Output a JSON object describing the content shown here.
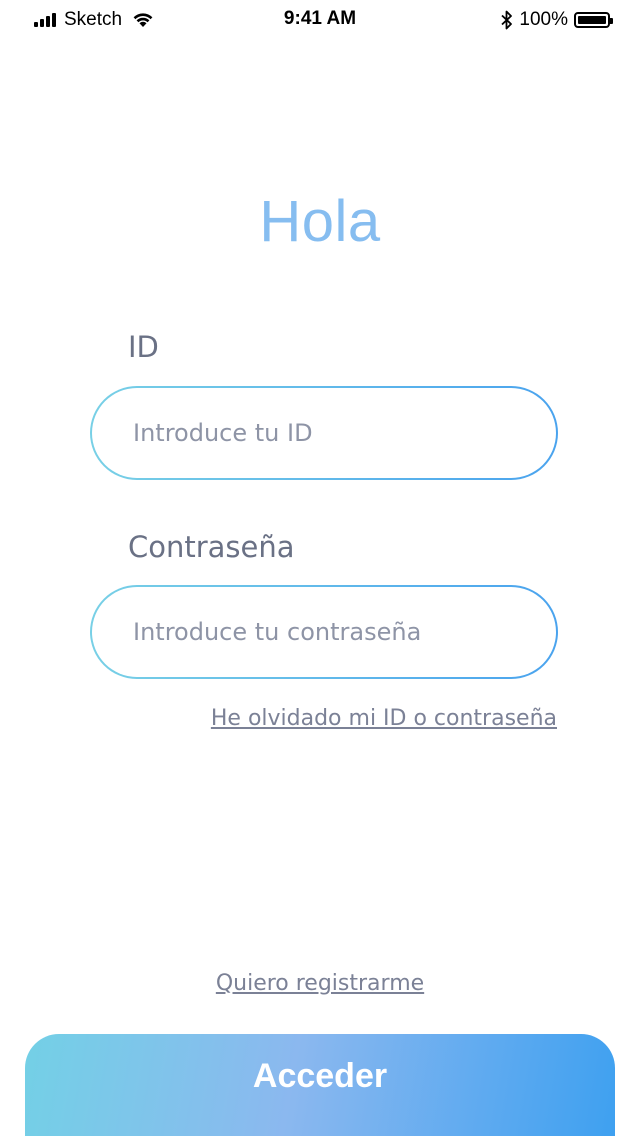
{
  "status_bar": {
    "carrier": "Sketch",
    "time": "9:41 AM",
    "battery_percent": "100%",
    "battery_level": 1.0,
    "icons": [
      "signal-icon",
      "wifi-icon",
      "bluetooth-icon",
      "battery-icon"
    ]
  },
  "login": {
    "title": "Hola",
    "id_label": "ID",
    "id_placeholder": "Introduce tu ID",
    "id_value": "",
    "password_label": "Contraseña",
    "password_placeholder": "Introduce tu contraseña",
    "password_value": "",
    "forgot_link": "He olvidado mi ID o contraseña",
    "register_link": "Quiero registrarme",
    "submit_label": "Acceder"
  },
  "colors": {
    "title": "#86bdf0",
    "label": "#6a7185",
    "field_border_start": "#78d0e6",
    "field_border_end": "#4aa3ee",
    "button_gradient_start": "#73d0e6",
    "button_gradient_end": "#3da0f0"
  }
}
